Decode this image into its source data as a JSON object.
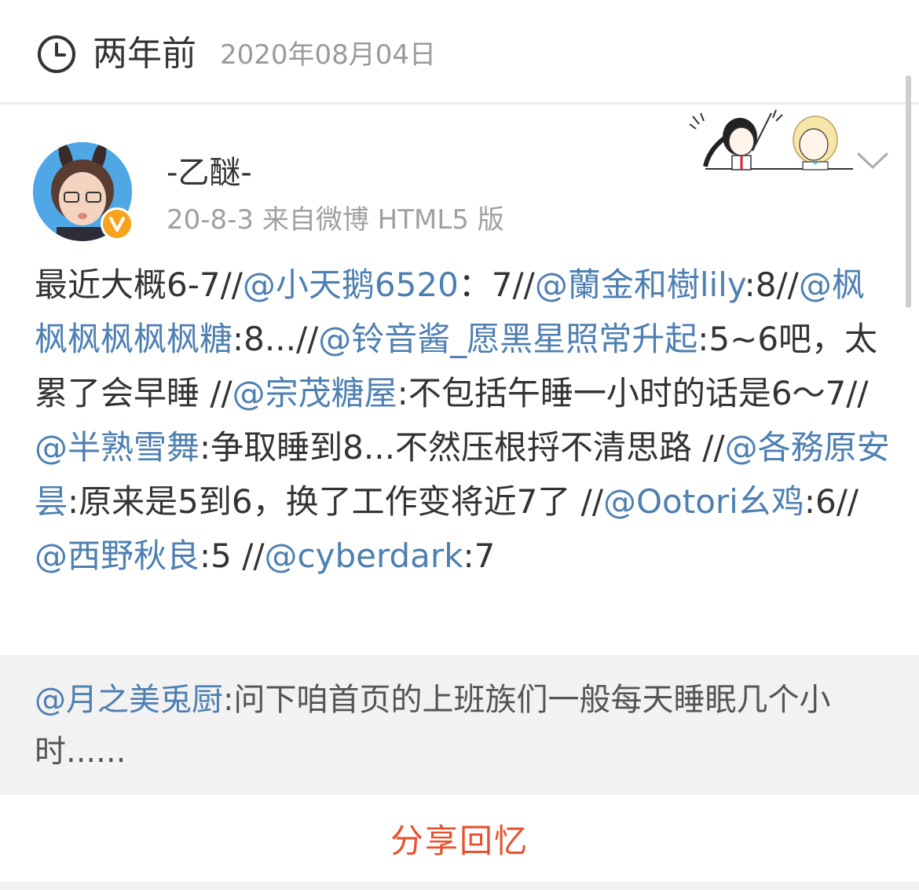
{
  "header": {
    "icon": "clock-icon",
    "relative_time": "两年前",
    "date": "2020年08月04日"
  },
  "post": {
    "username": "-乙醚-",
    "verified_badge": "v-badge-icon",
    "meta": "20-8-3  来自微博 HTML5 版",
    "segments": [
      {
        "t": "最近大概6-7//",
        "m": false
      },
      {
        "t": "@小天鹅6520",
        "m": true
      },
      {
        "t": "：7//",
        "m": false
      },
      {
        "t": "@蘭金和樹lily",
        "m": true
      },
      {
        "t": ":8//",
        "m": false
      },
      {
        "t": "@枫枫枫枫枫枫糖",
        "m": true
      },
      {
        "t": ":8...//",
        "m": false
      },
      {
        "t": "@铃音酱_愿黑星照常升起",
        "m": true
      },
      {
        "t": ":5~6吧，太累了会早睡 //",
        "m": false
      },
      {
        "t": "@宗茂糖屋",
        "m": true
      },
      {
        "t": ":不包括午睡一小时的话是6～7//",
        "m": false
      },
      {
        "t": "@半熟雪舞",
        "m": true
      },
      {
        "t": ":争取睡到8...不然压根捋不清思路 //",
        "m": false
      },
      {
        "t": "@各務原安昙",
        "m": true
      },
      {
        "t": ":原来是5到6，换了工作变将近7了 //",
        "m": false
      },
      {
        "t": "@Ootori幺鸡",
        "m": true
      },
      {
        "t": ":6//",
        "m": false
      },
      {
        "t": "@西野秋良",
        "m": true
      },
      {
        "t": ":5 //",
        "m": false
      },
      {
        "t": "@cyberdark",
        "m": true
      },
      {
        "t": ":7",
        "m": false
      }
    ]
  },
  "quote": {
    "mention": "@月之美兎厨",
    "text": ":问下咱首页的上班族们一般每天睡眠几个小时......"
  },
  "share_button": "分享回忆",
  "colors": {
    "mention": "#4e7fb1",
    "share": "#e8512e",
    "badge": "#f7a21b",
    "avatar_bg": "#4fa7e6"
  }
}
